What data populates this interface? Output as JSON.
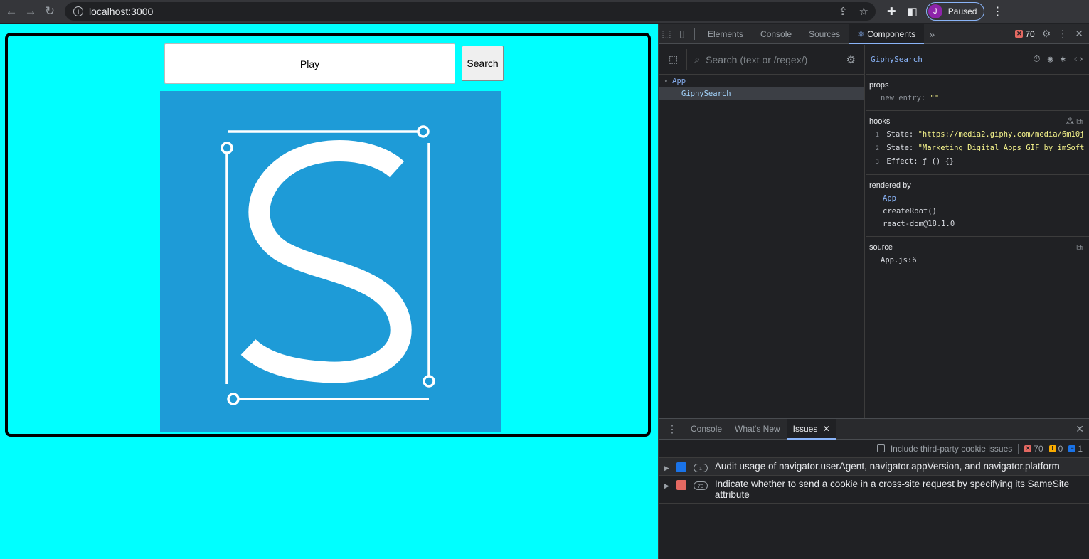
{
  "browser": {
    "url": "localhost:3000",
    "profile_initial": "J",
    "profile_status": "Paused"
  },
  "page": {
    "input_value": "Play",
    "search_button_label": "Search",
    "bg_color": "#00ffff",
    "gif_color": "#1e9bd7"
  },
  "devtools": {
    "tabs": [
      "Elements",
      "Console",
      "Sources",
      "Components"
    ],
    "active_tab": "Components",
    "error_count": "70",
    "search_placeholder": "Search (text or /regex/)",
    "tree": {
      "root": "App",
      "child": "GiphySearch"
    },
    "inspector": {
      "component": "GiphySearch",
      "props_title": "props",
      "props": [
        {
          "key": "new entry:",
          "value": "\"\""
        }
      ],
      "hooks_title": "hooks",
      "hooks": [
        {
          "n": "1",
          "key": "State:",
          "value": "\"https://media2.giphy.com/media/6m10j"
        },
        {
          "n": "2",
          "key": "State:",
          "value": "\"Marketing Digital Apps GIF by imSoft"
        },
        {
          "n": "3",
          "key": "Effect:",
          "value": "ƒ () {}"
        }
      ],
      "rendered_title": "rendered by",
      "rendered_by": [
        "App",
        "createRoot()",
        "react-dom@18.1.0"
      ],
      "source_title": "source",
      "source": "App.js:6"
    }
  },
  "drawer": {
    "tabs": [
      "Console",
      "What's New",
      "Issues"
    ],
    "active_tab": "Issues",
    "include_third_party": "Include third-party cookie issues",
    "counts": {
      "errors": "70",
      "warnings": "0",
      "info": "1"
    },
    "issues": [
      {
        "count": "1",
        "text": "Audit usage of navigator.userAgent, navigator.appVersion, and navigator.platform",
        "kind_color": "#1a73e8"
      },
      {
        "count": "70",
        "text": "Indicate whether to send a cookie in a cross-site request by specifying its SameSite attribute",
        "kind_color": "#e46962"
      }
    ]
  }
}
